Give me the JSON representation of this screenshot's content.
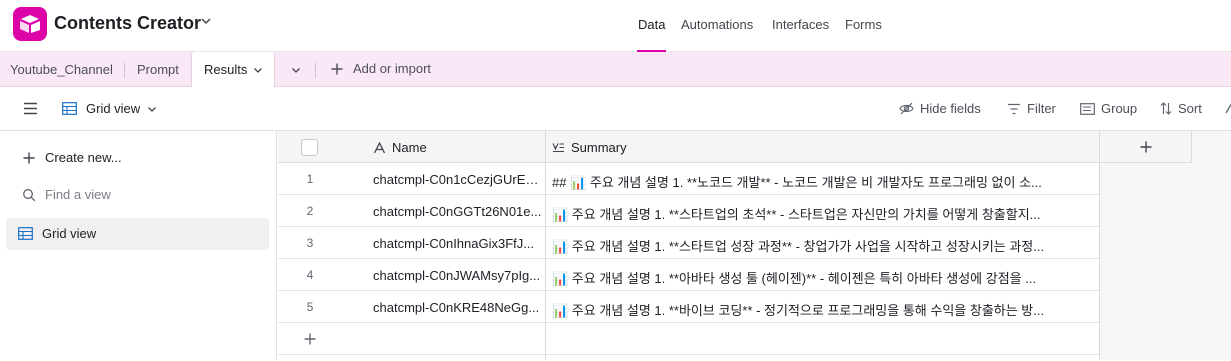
{
  "app": {
    "title": "Contents Creator",
    "brand_color": "#dc04a9"
  },
  "top_nav": {
    "items": [
      "Data",
      "Automations",
      "Interfaces",
      "Forms"
    ],
    "active": "Data"
  },
  "tables": {
    "items": [
      "Youtube_Channel",
      "Prompt",
      "Results"
    ],
    "active": "Results",
    "add_label": "Add or import"
  },
  "view_toolbar": {
    "view_name": "Grid view",
    "hide_fields": "Hide fields",
    "filter": "Filter",
    "group": "Group",
    "sort": "Sort"
  },
  "sidebar": {
    "create_new": "Create new...",
    "find_placeholder": "Find a view",
    "views": [
      "Grid view"
    ]
  },
  "grid": {
    "columns": [
      {
        "label": "Name",
        "icon": "text-field-icon"
      },
      {
        "label": "Summary",
        "icon": "long-text-icon"
      }
    ],
    "rows": [
      {
        "num": "1",
        "name": "chatcmpl-C0n1cCezjGUrEg...",
        "summary": "## 📊 주요 개념 설명 1. **노코드 개발** - 노코드 개발은 비 개발자도 프로그래밍 없이 소..."
      },
      {
        "num": "2",
        "name": "chatcmpl-C0nGGTt26N01e...",
        "summary": "📊 주요 개념 설명 1. **스타트업의 초석** - 스타트업은 자신만의 가치를 어떻게 창출할지..."
      },
      {
        "num": "3",
        "name": "chatcmpl-C0nIhnaGix3FfJ...",
        "summary": "📊 주요 개념 설명 1. **스타트업 성장 과정** - 창업가가 사업을 시작하고 성장시키는 과정..."
      },
      {
        "num": "4",
        "name": "chatcmpl-C0nJWAMsy7pIg...",
        "summary": "📊 주요 개념 설명 1. **아바타 생성 툴 (헤이젠)** - 헤이젠은 특히 아바타 생성에 강점을 ..."
      },
      {
        "num": "5",
        "name": "chatcmpl-C0nKRE48NeGg...",
        "summary": "📊 주요 개념 설명 1. **바이브 코딩** - 정기적으로 프로그래밍을 통해 수익을 창출하는 방..."
      }
    ]
  }
}
